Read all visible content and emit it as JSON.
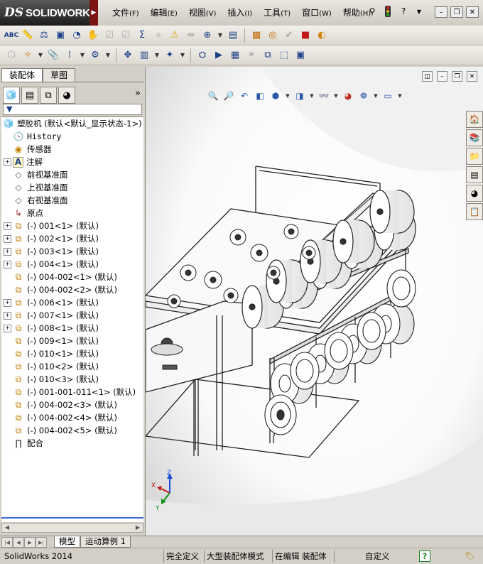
{
  "app": {
    "logo_prefix": "DS",
    "logo_name": "SOLIDWORKS",
    "menus": [
      {
        "label": "文件",
        "key": "(F)"
      },
      {
        "label": "编辑",
        "key": "(E)"
      },
      {
        "label": "视图",
        "key": "(V)"
      },
      {
        "label": "插入",
        "key": "(I)"
      },
      {
        "label": "工具",
        "key": "(T)"
      },
      {
        "label": "窗口",
        "key": "(W)"
      },
      {
        "label": "帮助",
        "key": "(H)"
      }
    ]
  },
  "left_panel": {
    "tabs": [
      "装配体",
      "草图"
    ],
    "active_tab": "装配体",
    "tree": [
      {
        "label": "塑胶机  (默认<默认_显示状态-1>)",
        "icon": "assembly-icon",
        "expander": "",
        "indent": 0
      },
      {
        "label": "History",
        "icon": "history-icon",
        "expander": "",
        "indent": 1
      },
      {
        "label": "传感器",
        "icon": "sensor-icon",
        "expander": "",
        "indent": 1
      },
      {
        "label": "注解",
        "icon": "annotation-icon",
        "expander": "+",
        "indent": 1
      },
      {
        "label": "前视基准面",
        "icon": "plane-icon",
        "expander": "",
        "indent": 1
      },
      {
        "label": "上视基准面",
        "icon": "plane-icon",
        "expander": "",
        "indent": 1
      },
      {
        "label": "右视基准面",
        "icon": "plane-icon",
        "expander": "",
        "indent": 1
      },
      {
        "label": "原点",
        "icon": "origin-icon",
        "expander": "",
        "indent": 1
      },
      {
        "label": "(-) 001<1> (默认)",
        "icon": "subassembly-icon",
        "expander": "+",
        "indent": 1
      },
      {
        "label": "(-) 002<1> (默认)",
        "icon": "subassembly-icon",
        "expander": "+",
        "indent": 1
      },
      {
        "label": "(-) 003<1> (默认)",
        "icon": "subassembly-icon",
        "expander": "+",
        "indent": 1
      },
      {
        "label": "(-) 004<1> (默认)",
        "icon": "subassembly-icon",
        "expander": "+",
        "indent": 1
      },
      {
        "label": "(-) 004-002<1> (默认)",
        "icon": "subassembly-icon",
        "expander": "",
        "indent": 1
      },
      {
        "label": "(-) 004-002<2> (默认)",
        "icon": "subassembly-icon",
        "expander": "",
        "indent": 1
      },
      {
        "label": "(-) 006<1> (默认)",
        "icon": "subassembly-icon",
        "expander": "+",
        "indent": 1
      },
      {
        "label": "(-) 007<1> (默认)",
        "icon": "subassembly-icon",
        "expander": "+",
        "indent": 1
      },
      {
        "label": "(-) 008<1> (默认)",
        "icon": "subassembly-icon",
        "expander": "+",
        "indent": 1
      },
      {
        "label": "(-) 009<1> (默认)",
        "icon": "subassembly-icon",
        "expander": "",
        "indent": 1
      },
      {
        "label": "(-) 010<1> (默认)",
        "icon": "subassembly-icon",
        "expander": "",
        "indent": 1
      },
      {
        "label": "(-) 010<2> (默认)",
        "icon": "subassembly-icon",
        "expander": "",
        "indent": 1
      },
      {
        "label": "(-) 010<3> (默认)",
        "icon": "subassembly-icon",
        "expander": "",
        "indent": 1
      },
      {
        "label": "(-) 001-001-011<1> (默认)",
        "icon": "subassembly-icon",
        "expander": "",
        "indent": 1
      },
      {
        "label": "(-) 004-002<3> (默认)",
        "icon": "subassembly-icon",
        "expander": "",
        "indent": 1
      },
      {
        "label": "(-) 004-002<4> (默认)",
        "icon": "subassembly-icon",
        "expander": "",
        "indent": 1
      },
      {
        "label": "(-) 004-002<5> (默认)",
        "icon": "subassembly-icon",
        "expander": "",
        "indent": 1
      },
      {
        "label": "配合",
        "icon": "mates-icon",
        "expander": "",
        "indent": 1
      }
    ]
  },
  "bottom_tabs": [
    "模型",
    "运动算例 1"
  ],
  "active_bottom_tab": "模型",
  "status": {
    "app_version": "SolidWorks 2014",
    "definition": "完全定义",
    "mode": "大型装配体模式",
    "editing": "在编辑 装配体",
    "units": "自定义",
    "help": "?"
  },
  "triad": {
    "x": "X",
    "y": "Y",
    "z": "Z"
  },
  "colors": {
    "window_bg": "#d4d0c8",
    "selection_line": "#3a6ad4",
    "brand_red": "#7a1414"
  }
}
